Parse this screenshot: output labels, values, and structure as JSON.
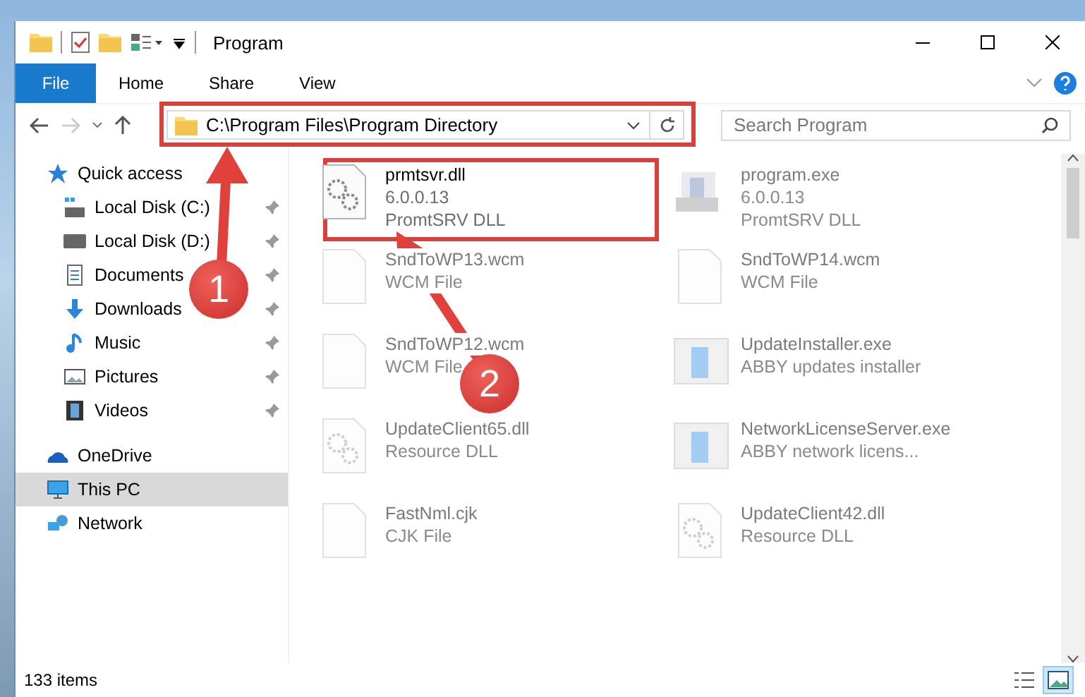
{
  "window": {
    "title": "Program"
  },
  "ribbon_tabs": [
    {
      "label": "File",
      "kind": "file",
      "selected": false
    },
    {
      "label": "Home",
      "kind": "tab",
      "selected": false
    },
    {
      "label": "Share",
      "kind": "tab",
      "selected": false
    },
    {
      "label": "View",
      "kind": "tab",
      "selected": false
    }
  ],
  "address_bar": {
    "path": "C:\\Program Files\\Program Directory"
  },
  "search": {
    "placeholder": "Search Program"
  },
  "sidebar": {
    "items": [
      {
        "label": "Quick access",
        "kind": "star",
        "selected": false,
        "children": [
          {
            "label": "Local Disk (C:)",
            "kind": "system-drive",
            "pinned": true,
            "selected": false
          },
          {
            "label": "Local Disk (D:)",
            "kind": "drive",
            "pinned": true,
            "selected": false
          },
          {
            "label": "Documents",
            "kind": "documents",
            "pinned": true,
            "selected": false
          },
          {
            "label": "Downloads",
            "kind": "downloads",
            "pinned": true,
            "selected": false
          },
          {
            "label": "Music",
            "kind": "music",
            "pinned": true,
            "selected": false
          },
          {
            "label": "Pictures",
            "kind": "pictures",
            "pinned": true,
            "selected": false
          },
          {
            "label": "Videos",
            "kind": "videos",
            "pinned": true,
            "selected": false
          }
        ]
      },
      {
        "label": "OneDrive",
        "kind": "cloud",
        "selected": false
      },
      {
        "label": "This PC",
        "kind": "computer",
        "selected": true
      },
      {
        "label": "Network",
        "kind": "network",
        "selected": false
      }
    ]
  },
  "files": [
    {
      "name": "prmtsvr.dll",
      "details": [
        "6.0.0.13",
        "PromtSRV DLL"
      ],
      "kind": "dll",
      "faded": false
    },
    {
      "name": "program.exe",
      "details": [
        "6.0.0.13",
        "PromtSRV DLL"
      ],
      "kind": "exe",
      "faded": true
    },
    {
      "name": "SndToWP13.wcm",
      "details": [
        "WCM File"
      ],
      "kind": "file",
      "faded": true
    },
    {
      "name": "SndToWP14.wcm",
      "details": [
        "WCM File"
      ],
      "kind": "file",
      "faded": true
    },
    {
      "name": "SndToWP12.wcm",
      "details": [
        "WCM File"
      ],
      "kind": "file",
      "faded": true
    },
    {
      "name": "UpdateInstaller.exe",
      "details": [
        "ABBY updates installer"
      ],
      "kind": "installer",
      "faded": true
    },
    {
      "name": "UpdateClient65.dll",
      "details": [
        "Resource DLL"
      ],
      "kind": "dll",
      "faded": true
    },
    {
      "name": "NetworkLicenseServer.exe",
      "details": [
        "ABBY network licens..."
      ],
      "kind": "installer",
      "faded": true
    },
    {
      "name": "FastNml.cjk",
      "details": [
        "CJK File"
      ],
      "kind": "file",
      "faded": true
    },
    {
      "name": "UpdateClient42.dll",
      "details": [
        "Resource DLL"
      ],
      "kind": "dll",
      "faded": true
    }
  ],
  "status_bar": {
    "count": "133 items"
  },
  "view_buttons": [
    {
      "kind": "details",
      "selected": false
    },
    {
      "kind": "large-icons",
      "selected": true
    }
  ],
  "annotations": [
    {
      "label": "1"
    },
    {
      "label": "2"
    }
  ]
}
